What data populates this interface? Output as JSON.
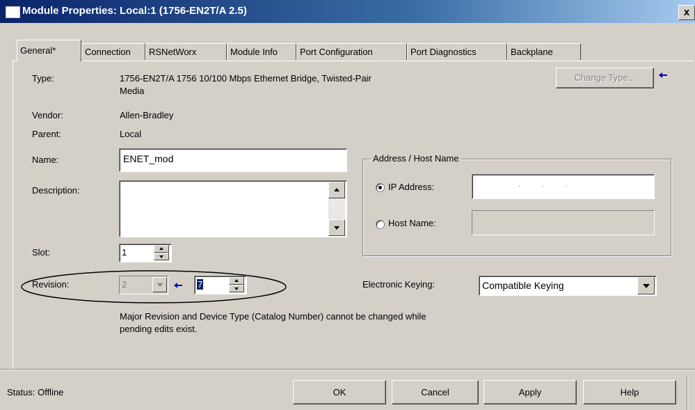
{
  "window": {
    "title": "Module Properties: Local:1 (1756-EN2T/A 2.5)",
    "close_glyph": "x"
  },
  "tabs": [
    {
      "label": "General*"
    },
    {
      "label": "Connection"
    },
    {
      "label": "RSNetWorx"
    },
    {
      "label": "Module Info"
    },
    {
      "label": "Port Configuration"
    },
    {
      "label": "Port Diagnostics"
    },
    {
      "label": "Backplane"
    }
  ],
  "general": {
    "type_label": "Type:",
    "type_value_line1": "1756-EN2T/A 1756 10/100 Mbps Ethernet Bridge, Twisted-Pair",
    "type_value_line2": "Media",
    "change_type_button": "Change Type...",
    "vendor_label": "Vendor:",
    "vendor_value": "Allen-Bradley",
    "parent_label": "Parent:",
    "parent_value": "Local",
    "name_label": "Name:",
    "name_value": "ENET_mod",
    "description_label": "Description:",
    "description_value": "",
    "slot_label": "Slot:",
    "slot_value": "1",
    "revision_label": "Revision:",
    "revision_major": "2",
    "revision_minor": "7",
    "address_group_title": "Address / Host Name",
    "ip_address_label": "IP Address:",
    "ip_address_value": ".          .          .",
    "ip_selected": true,
    "host_name_label": "Host Name:",
    "host_name_value": "",
    "keying_label": "Electronic Keying:",
    "keying_value": "Compatible Keying",
    "note_line1": "Major Revision and Device Type (Catalog Number) cannot be changed while",
    "note_line2": "pending edits exist."
  },
  "footer": {
    "status": "Status: Offline",
    "ok_button": "OK",
    "cancel_button": "Cancel",
    "apply_button": "Apply",
    "help_button": "Help"
  },
  "colors": {
    "titlebar_start": "#0a246a",
    "titlebar_end": "#a6caf0",
    "dialog_face": "#d4d0c8",
    "arrow_blue": "#0000c8"
  }
}
